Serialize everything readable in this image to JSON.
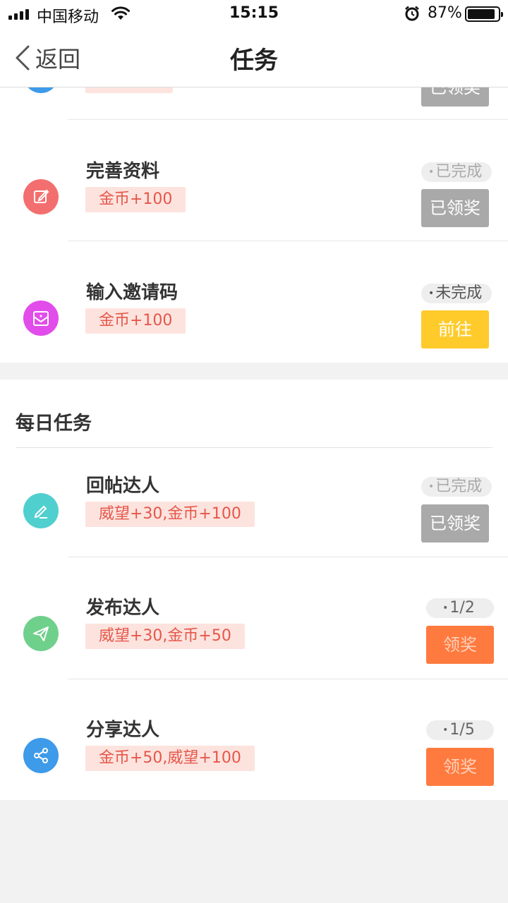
{
  "status_bar": {
    "carrier": "中国移动",
    "time": "15:15",
    "battery_percent": "87%",
    "battery_level": 0.87
  },
  "nav": {
    "back_label": "返回",
    "title": "任务",
    "back_icon": "chevron-left-icon"
  },
  "partial_task": {
    "button": "已领奖",
    "icon_color": "#3d9be9"
  },
  "novice_tasks": [
    {
      "title": "完善资料",
      "reward": "金币+100",
      "status": "已完成",
      "button": "已领奖",
      "icon": "edit-icon",
      "icon_color": "#f36f6f"
    },
    {
      "title": "输入邀请码",
      "reward": "金币+100",
      "status": "未完成",
      "button": "前往",
      "icon": "envelope-icon",
      "icon_color": "#e24cea"
    }
  ],
  "daily": {
    "section_title": "每日任务",
    "tasks": [
      {
        "title": "回帖达人",
        "reward": "威望+30,金币+100",
        "status": "已完成",
        "button": "已领奖",
        "icon": "pen-icon",
        "icon_color": "#50cfcf"
      },
      {
        "title": "发布达人",
        "reward": "威望+30,金币+50",
        "status": "1/2",
        "button": "领奖",
        "icon": "paper-plane-icon",
        "icon_color": "#6fd08c"
      },
      {
        "title": "分享达人",
        "reward": "金币+50,威望+100",
        "status": "1/5",
        "button": "领奖",
        "icon": "share-icon",
        "icon_color": "#3d9be9"
      }
    ]
  },
  "colors": {
    "claimed_button": "#a9a9a9",
    "go_button": "#ffcb2b",
    "claim_button": "#ff7a3e",
    "reward_tag_bg": "#fde3de",
    "reward_tag_text": "#e5574a"
  }
}
